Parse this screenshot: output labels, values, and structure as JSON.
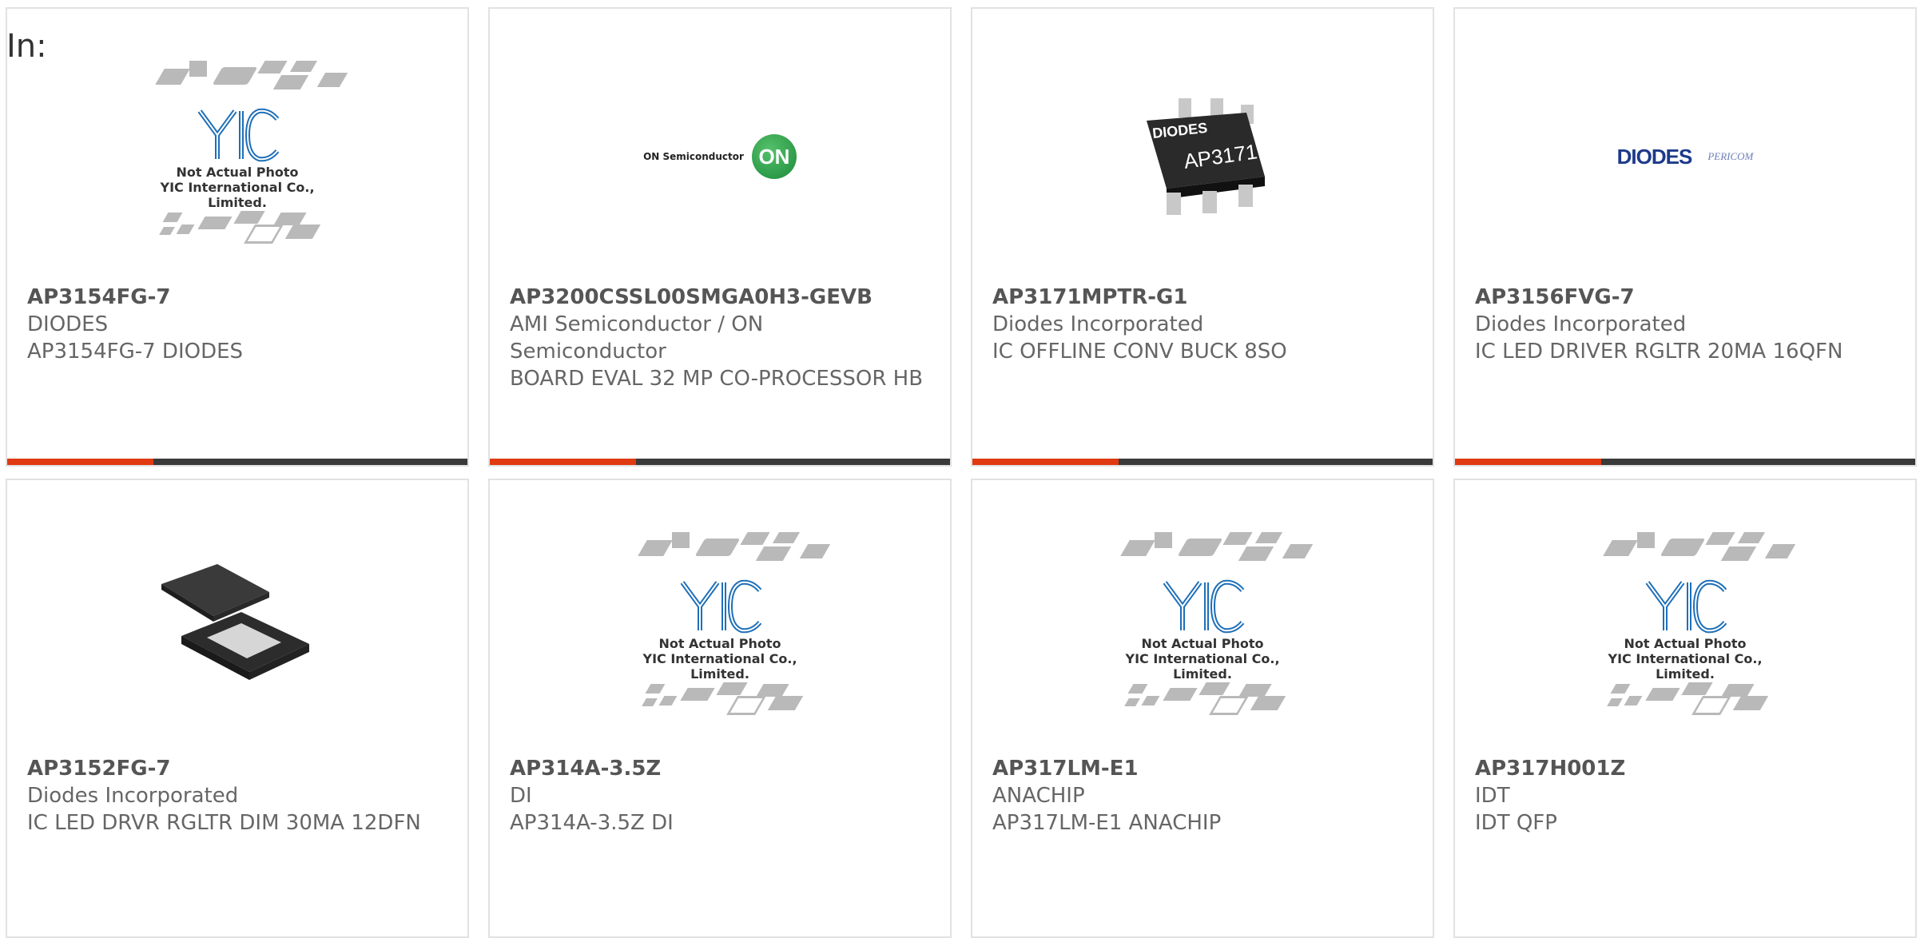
{
  "header": {
    "in_label": "In:"
  },
  "placeholder": {
    "line1": "Not Actual Photo",
    "line2": "YIC International Co., Limited."
  },
  "logos": {
    "on_text": "ON Semiconductor",
    "on_circle": "ON",
    "diodes": "DIODES",
    "pericom": "PERICOM"
  },
  "chip_label": "AP3171",
  "chip_brand": "DIODES",
  "products": [
    {
      "part": "AP3154FG-7",
      "mfr": "DIODES",
      "desc": "AP3154FG-7 DIODES",
      "image": "placeholder"
    },
    {
      "part": "AP3200CSSL00SMGA0H3-GEVB",
      "mfr": "AMI Semiconductor / ON Semiconductor",
      "desc": "BOARD EVAL 32 MP CO-PROCESSOR HB",
      "image": "on-logo"
    },
    {
      "part": "AP3171MPTR-G1",
      "mfr": "Diodes Incorporated",
      "desc": "IC OFFLINE CONV BUCK 8SO",
      "image": "chip-sot"
    },
    {
      "part": "AP3156FVG-7",
      "mfr": "Diodes Incorporated",
      "desc": "IC LED DRIVER RGLTR 20MA 16QFN",
      "image": "diodes-logo"
    },
    {
      "part": "AP3152FG-7",
      "mfr": "Diodes Incorporated",
      "desc": "IC LED DRVR RGLTR DIM 30MA 12DFN",
      "image": "chip-dfn"
    },
    {
      "part": "AP314A-3.5Z",
      "mfr": "DI",
      "desc": "AP314A-3.5Z DI",
      "image": "placeholder"
    },
    {
      "part": "AP317LM-E1",
      "mfr": "ANACHIP",
      "desc": "AP317LM-E1 ANACHIP",
      "image": "placeholder"
    },
    {
      "part": "AP317H001Z",
      "mfr": "IDT",
      "desc": "IDT QFP",
      "image": "placeholder"
    }
  ],
  "colors": {
    "accent": "#e03a12",
    "bar": "#3a3a3a",
    "border": "#e2e2e2"
  }
}
